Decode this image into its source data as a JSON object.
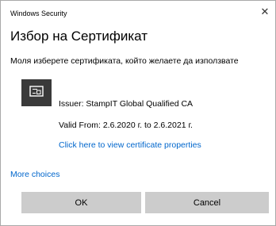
{
  "window": {
    "title": "Windows Security",
    "close_glyph": "✕"
  },
  "dialog": {
    "heading": "Избор на Сертификат",
    "subheading": "Моля изберете сертификата, който желаете да използвате"
  },
  "certificate": {
    "icon": "certificate-icon",
    "issuer": "Issuer: StampIT Global Qualified CA",
    "valid_from": "Valid From: 2.6.2020 г. to 2.6.2021 г.",
    "properties_link": "Click here to view certificate properties"
  },
  "more_choices": "More choices",
  "buttons": {
    "ok": "OK",
    "cancel": "Cancel"
  },
  "colors": {
    "link": "#0066cc",
    "button_bg": "#cccccc",
    "icon_bg": "#3a3a3a"
  }
}
